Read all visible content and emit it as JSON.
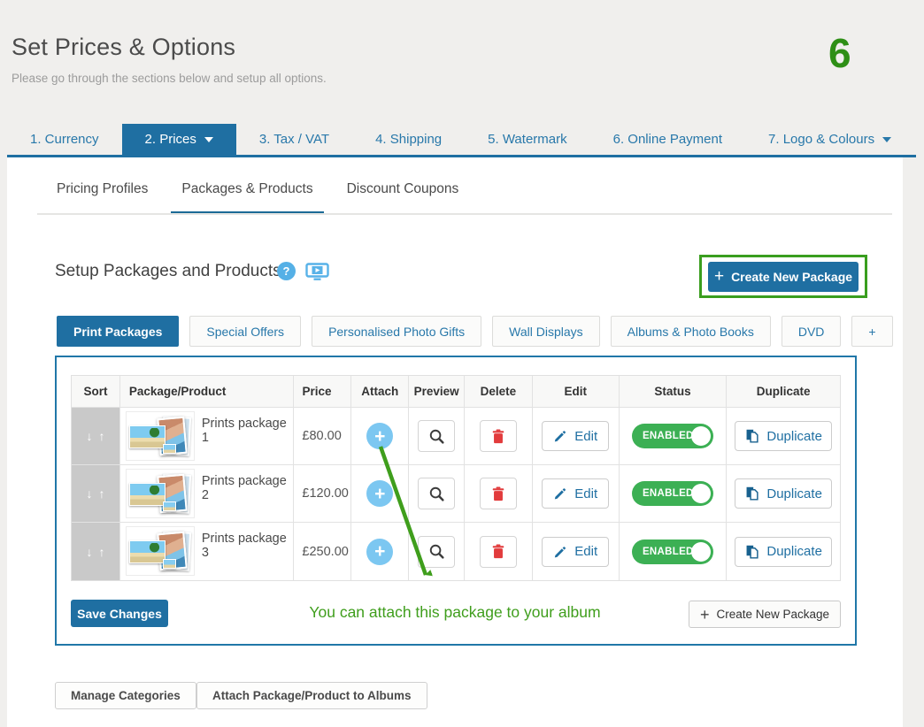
{
  "page": {
    "title": "Set Prices & Options",
    "subtitle": "Please go through the sections below and setup all options.",
    "step_number": "6"
  },
  "main_tabs": [
    {
      "label": "1. Currency"
    },
    {
      "label": "2. Prices",
      "active": true,
      "has_caret": true
    },
    {
      "label": "3. Tax / VAT"
    },
    {
      "label": "4. Shipping"
    },
    {
      "label": "5. Watermark"
    },
    {
      "label": "6. Online Payment"
    },
    {
      "label": "7. Logo & Colours",
      "has_caret": true
    }
  ],
  "sub_tabs": [
    {
      "label": "Pricing Profiles"
    },
    {
      "label": "Packages & Products",
      "active": true
    },
    {
      "label": "Discount Coupons"
    }
  ],
  "section": {
    "heading": "Setup Packages and Products",
    "help_glyph": "?",
    "create_new_package": "Create New Package",
    "plus_glyph": "+"
  },
  "package_tabs": [
    {
      "label": "Print Packages",
      "active": true
    },
    {
      "label": "Special Offers"
    },
    {
      "label": "Personalised Photo Gifts"
    },
    {
      "label": "Wall Displays"
    },
    {
      "label": "Albums & Photo Books"
    },
    {
      "label": "DVD"
    },
    {
      "label": "+"
    }
  ],
  "table": {
    "columns": [
      "Sort",
      "Package/Product",
      "Price",
      "Attach",
      "Preview",
      "Delete",
      "Edit",
      "Status",
      "Duplicate"
    ],
    "rows": [
      {
        "name": "Prints package 1",
        "price": "£80.00",
        "status": "ENABLED",
        "edit_label": "Edit",
        "duplicate_label": "Duplicate"
      },
      {
        "name": "Prints package 2",
        "price": "£120.00",
        "status": "ENABLED",
        "edit_label": "Edit",
        "duplicate_label": "Duplicate"
      },
      {
        "name": "Prints package 3",
        "price": "£250.00",
        "status": "ENABLED",
        "edit_label": "Edit",
        "duplicate_label": "Duplicate"
      }
    ]
  },
  "table_footer": {
    "save_button": "Save Changes",
    "annotation": "You can attach this package to your album",
    "create_new_package": "Create New Package",
    "plus_glyph": "+"
  },
  "bottom_actions": {
    "manage_categories": "Manage Categories",
    "attach_to_albums": "Attach Package/Product to Albums"
  },
  "icons": {
    "sort_down": "↓",
    "sort_up": "↑",
    "attach_plus": "+"
  },
  "colors": {
    "primary_blue": "#1f6fa2",
    "link_blue": "#2878aa",
    "light_blue_icon": "#55b0e6",
    "attach_blue": "#7cc7f1",
    "toggle_green": "#3cb054",
    "annotation_green": "#3f9e1c",
    "step_green": "#2e8f16",
    "delete_red": "#e23b3c",
    "page_background": "#f0efed"
  }
}
